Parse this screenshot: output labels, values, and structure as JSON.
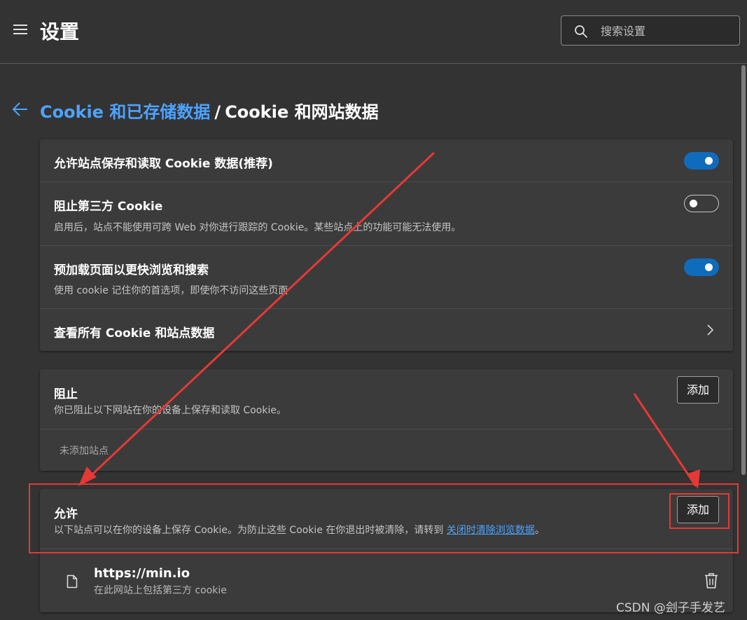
{
  "header": {
    "title": "设置",
    "search_placeholder": "搜索设置"
  },
  "breadcrumb": {
    "parent": "Cookie 和已存储数据",
    "separator": "/",
    "current": "Cookie 和网站数据"
  },
  "settings": [
    {
      "title": "允许站点保存和读取 Cookie 数据(推荐)",
      "desc": "",
      "toggle": "on"
    },
    {
      "title": "阻止第三方 Cookie",
      "desc": "启用后，站点不能使用可跨 Web 对你进行跟踪的 Cookie。某些站点上的功能可能无法使用。",
      "toggle": "off"
    },
    {
      "title": "预加载页面以更快浏览和搜索",
      "desc": "使用 cookie 记住你的首选项，即使你不访问这些页面",
      "toggle": "on"
    },
    {
      "title": "查看所有 Cookie 和站点数据",
      "desc": "",
      "toggle": "chevron"
    }
  ],
  "block": {
    "title": "阻止",
    "desc": "你已阻止以下网站在你的设备上保存和读取 Cookie。",
    "add_label": "添加",
    "empty_text": "未添加站点"
  },
  "allow": {
    "title": "允许",
    "desc_prefix": "以下站点可以在你的设备上保存 Cookie。为防止这些 Cookie 在你退出时被清除，请转到",
    "desc_link": "关闭时清除浏览数据",
    "desc_suffix": "。",
    "add_label": "添加",
    "sites": [
      {
        "url": "https://min.io",
        "sub": "在此网站上包括第三方 cookie"
      }
    ]
  },
  "watermark": "CSDN @刽子手发艺",
  "colors": {
    "background": "#333333",
    "card": "#3b3b3b",
    "accent": "#4da3ff",
    "toggle_on": "#0f6cbd",
    "annotation": "#e53935"
  },
  "icons": [
    "menu-icon",
    "search-icon",
    "back-arrow-icon",
    "chevron-right-icon",
    "file-icon",
    "trash-icon"
  ]
}
